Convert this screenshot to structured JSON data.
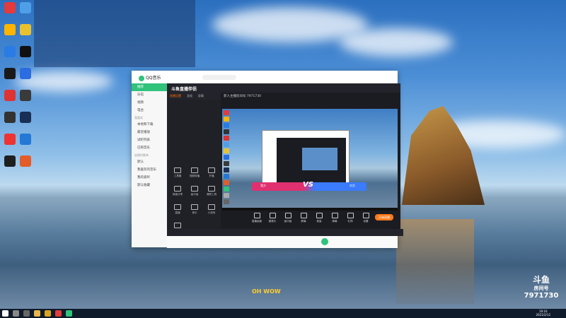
{
  "desktop": {
    "icons": [
      {
        "label": "",
        "color": "#e23b3b"
      },
      {
        "label": "",
        "color": "#ffb400"
      },
      {
        "label": "",
        "color": "#2a7be4"
      },
      {
        "label": "",
        "color": "#1a1a1a"
      },
      {
        "label": "",
        "color": "#d33"
      },
      {
        "label": "",
        "color": "#333"
      },
      {
        "label": "",
        "color": "#e33"
      },
      {
        "label": "",
        "color": "#1f1f1f"
      },
      {
        "label": "",
        "color": "#4f9fe8"
      },
      {
        "label": "",
        "color": "#e8c12f"
      },
      {
        "label": "",
        "color": "#111"
      },
      {
        "label": "",
        "color": "#2b6de0"
      },
      {
        "label": "",
        "color": "#3a3a3a"
      },
      {
        "label": "",
        "color": "#1a2f55"
      },
      {
        "label": "",
        "color": "#2478d6"
      },
      {
        "label": "",
        "color": "#e35c2a"
      }
    ]
  },
  "overlay": {
    "rows": [
      "",
      "",
      "",
      "",
      "",
      "",
      "",
      "",
      ""
    ]
  },
  "qq": {
    "title": "QQ音乐",
    "sidebar": [
      "推荐",
      "乐馆",
      "视频",
      "电台",
      "我喜欢",
      "本地和下载",
      "最近播放",
      "试听列表",
      "已购音乐",
      "创建的歌单",
      "默认",
      "我喜欢的音乐",
      "我的爱听",
      "默认收藏"
    ],
    "active_index": 0
  },
  "douyu": {
    "brand": "斗鱼直播伴侣",
    "tabs": [
      "直播设置",
      "游戏",
      "屏幕"
    ],
    "room_info": "新人主播房间号 7971730",
    "tools_left": [
      "工具箱",
      "视频转播",
      "开播",
      "频道分享",
      "画中画",
      "清屏工具",
      "直播",
      "音乐",
      "小游戏",
      "上手一键设"
    ],
    "preview": {
      "left_team": "我方",
      "right_team": "对方",
      "vs": "VS"
    },
    "controls": [
      "直播画面",
      "摄像头",
      "画中画",
      "屏幕",
      "音量",
      "弹幕",
      "礼物",
      "设置"
    ],
    "live_button": "开始直播"
  },
  "watermark": {
    "brand": "斗鱼",
    "sub": "房间号",
    "room": "7971730"
  },
  "wow_text": "OH WOW",
  "taskbar": {
    "time": "19:16",
    "date": "2021/2/12"
  },
  "colors": {
    "accent_qq": "#31c27c",
    "accent_douyu": "#ff7a1a"
  }
}
